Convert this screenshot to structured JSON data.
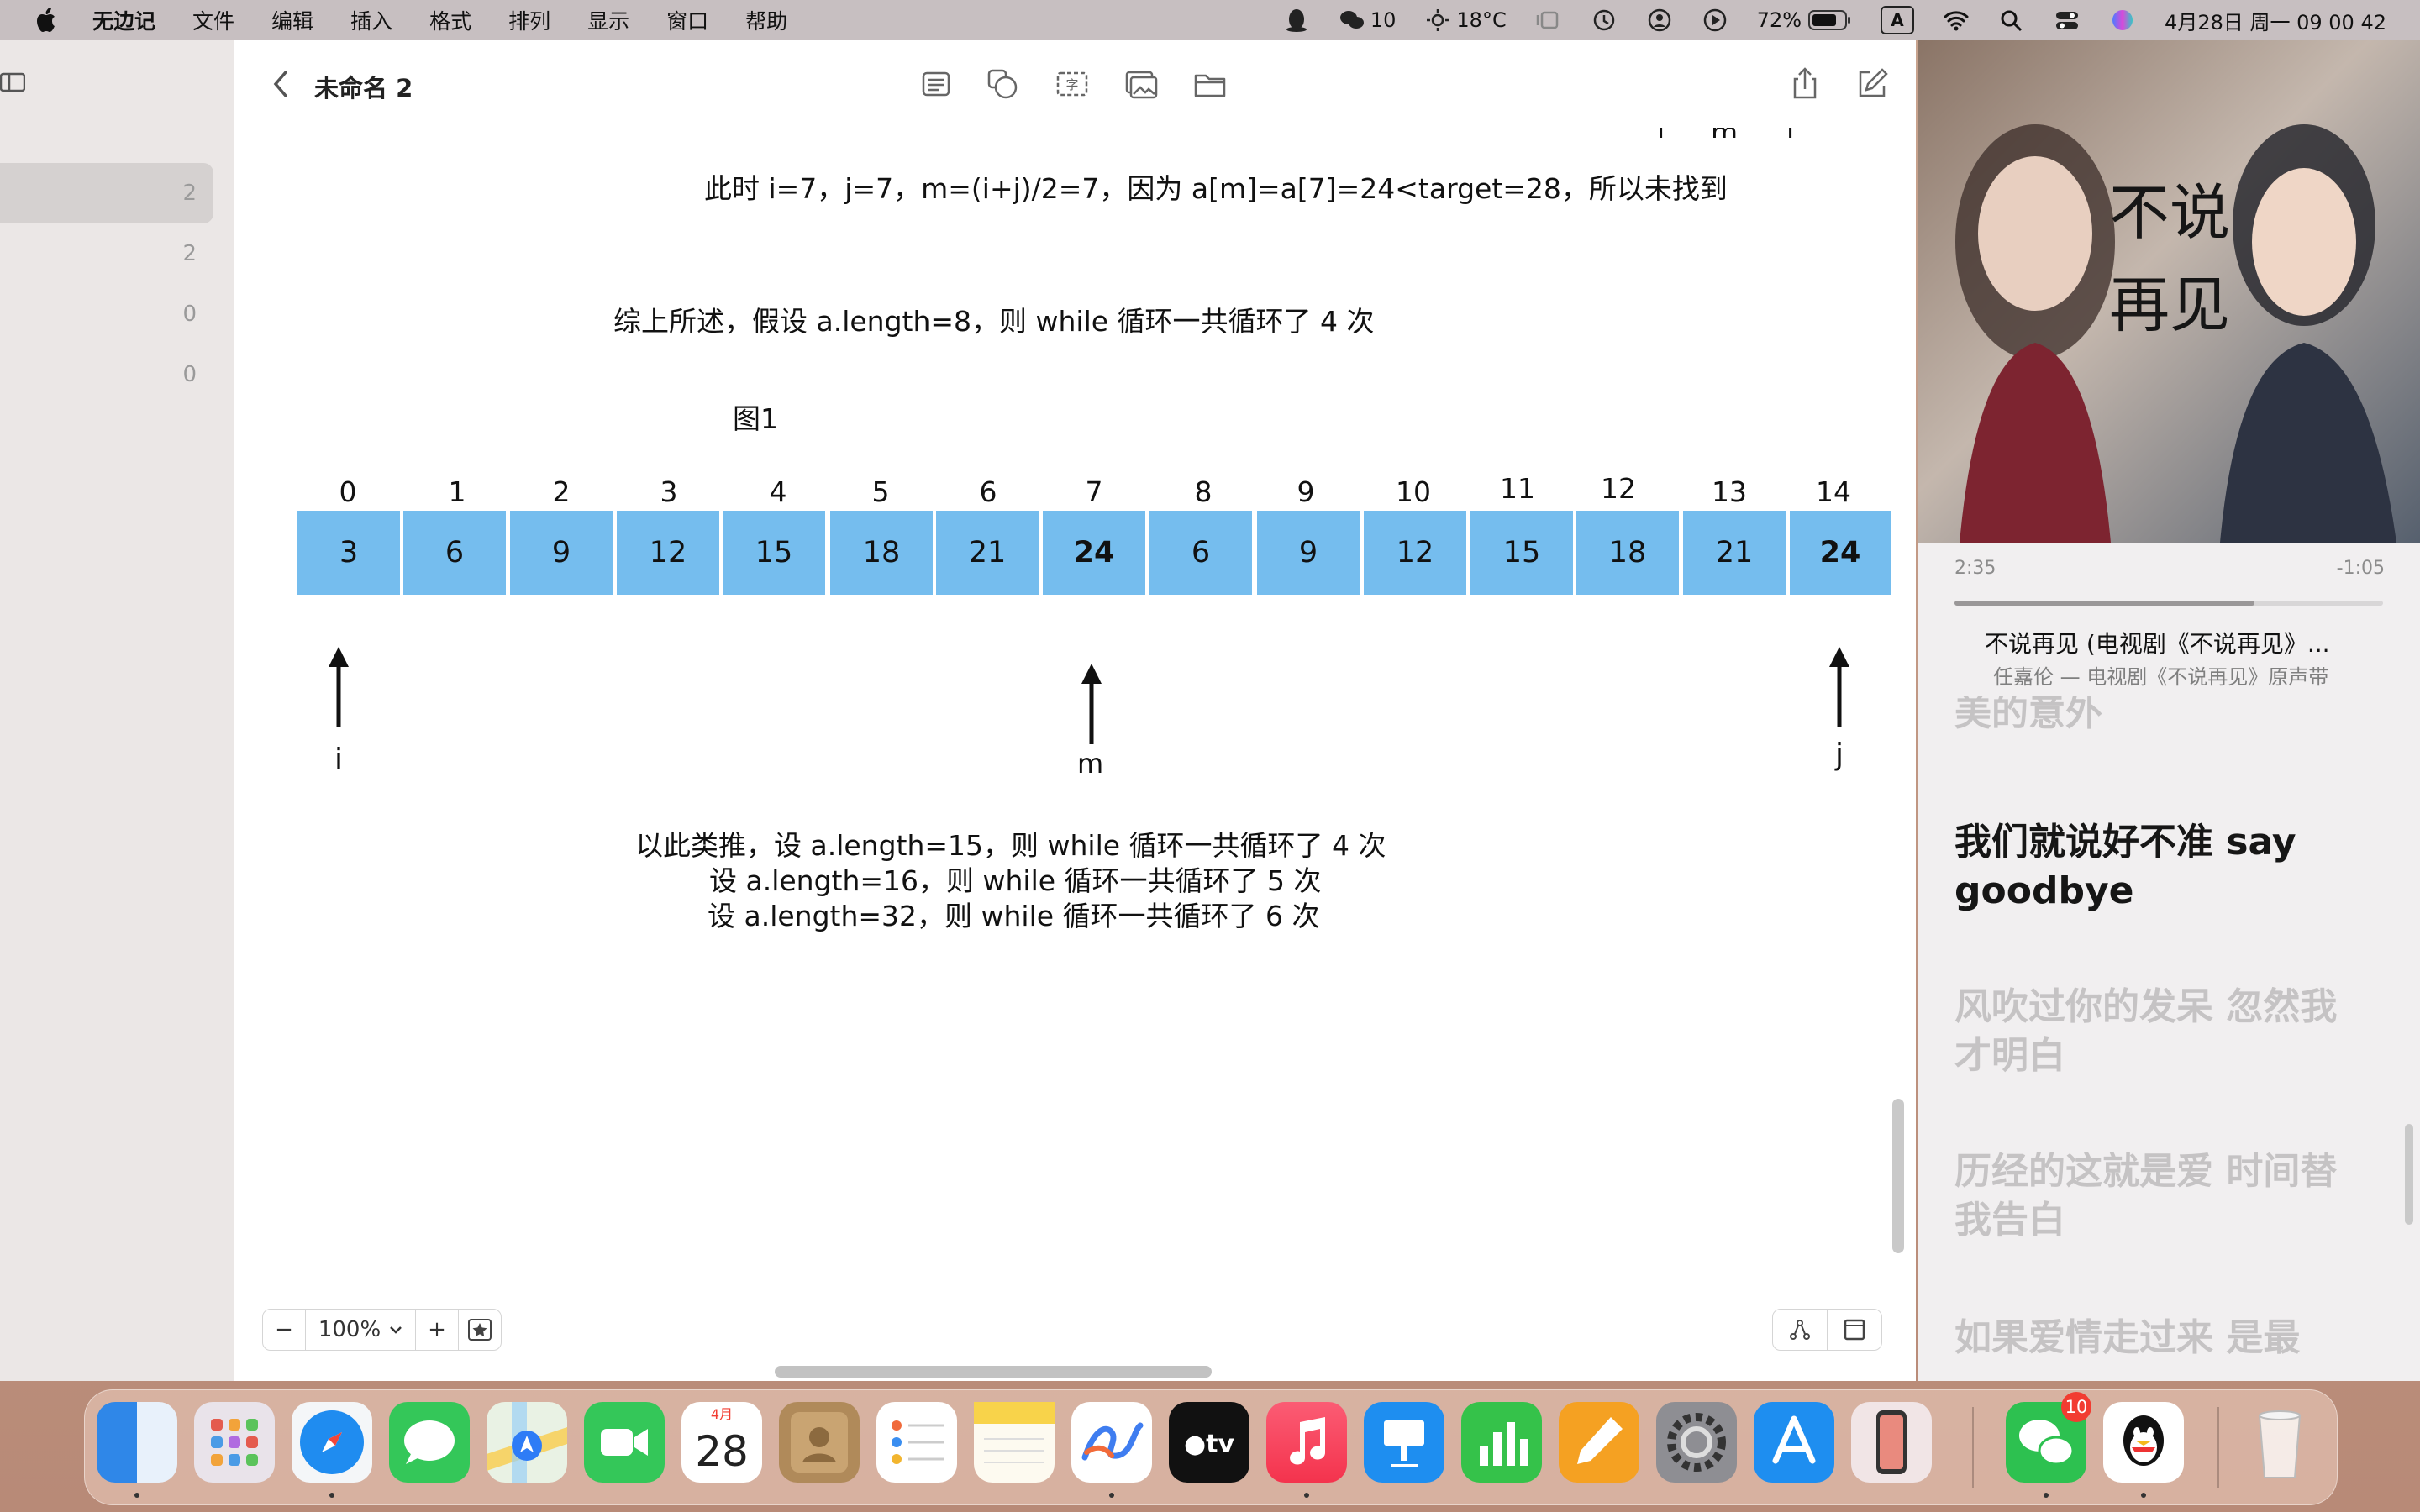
{
  "menubar": {
    "app_name": "无边记",
    "menus": [
      "文件",
      "编辑",
      "插入",
      "格式",
      "排列",
      "显示",
      "窗口",
      "帮助"
    ],
    "wechat_count": "10",
    "weather": "18°C",
    "battery": "72%",
    "input_method": "A",
    "datetime": "4月28日 周一  09 00 42"
  },
  "sidebar": {
    "counts": [
      "2",
      "2",
      "0",
      "0"
    ]
  },
  "toolbar": {
    "title": "未命名 2"
  },
  "canvas": {
    "line1": "此时 i=7，j=7，m=(i+j)/2=7，因为 a[m]=a[7]=24<target=28，所以未找到",
    "summary": "综上所述，假设 a.length=8，则 while 循环一共循环了 4 次",
    "figure_label": "图1",
    "indices": [
      "0",
      "1",
      "2",
      "3",
      "4",
      "5",
      "6",
      "7",
      "8",
      "9",
      "10",
      "11",
      "12",
      "13",
      "14"
    ],
    "values": [
      "3",
      "6",
      "9",
      "12",
      "15",
      "18",
      "21",
      "24",
      "6",
      "9",
      "12",
      "15",
      "18",
      "21",
      "24"
    ],
    "pointer_i": "i",
    "pointer_m": "m",
    "pointer_j": "j",
    "top_cut_labels": [
      "i",
      "m",
      "j"
    ],
    "conclusion_1": "以此类推，设 a.length=15，则 while 循环一共循环了 4 次",
    "conclusion_2": "设 a.length=16，则 while 循环一共循环了 5 次",
    "conclusion_3": "设 a.length=32，则 while 循环一共循环了 6 次",
    "cell_color": "#75bdee"
  },
  "zoom": {
    "minus": "−",
    "level": "100%",
    "plus": "+"
  },
  "music": {
    "elapsed": "2:35",
    "remaining": "-1:05",
    "progress": 0.7,
    "song": "不说再见 (电视剧《不说再见》...",
    "artist": "任嘉伦 — 电视剧《不说再见》原声带",
    "lyrics": [
      "美的意外",
      "我们就说好不准 say goodbye",
      "风吹过你的发呆 忽然我才明白",
      "历经的这就是爱 时间替我告白",
      "如果爱情走过来 是最"
    ],
    "cover_title": "不说再见"
  },
  "dock": {
    "calendar_month": "4月",
    "calendar_day": "28",
    "wechat_badge": "10"
  }
}
